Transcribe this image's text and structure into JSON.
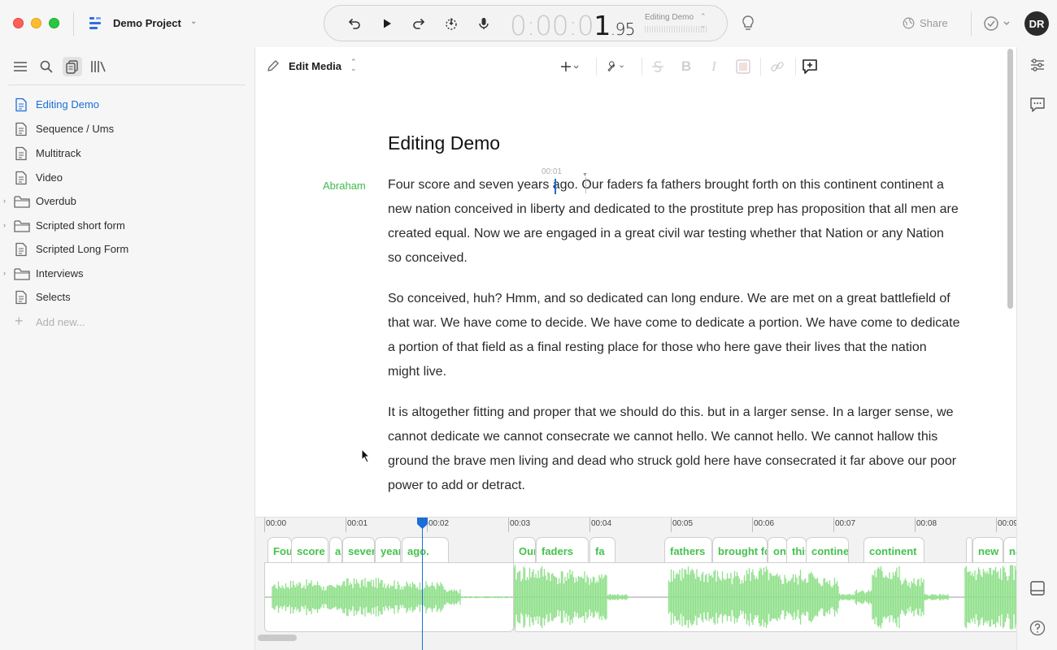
{
  "window": {
    "project_name": "Demo Project",
    "timecode_dim": "0:00:0",
    "timecode_hl": "1",
    "timecode_frac": ".95",
    "composition": "Editing Demo",
    "share_label": "Share",
    "avatar_initials": "DR"
  },
  "sidebar": {
    "items": [
      {
        "label": "Editing Demo",
        "type": "doc",
        "selected": true
      },
      {
        "label": "Sequence / Ums",
        "type": "doc"
      },
      {
        "label": "Multitrack",
        "type": "doc"
      },
      {
        "label": "Video",
        "type": "doc"
      },
      {
        "label": "Overdub",
        "type": "folder"
      },
      {
        "label": "Scripted short form",
        "type": "folder"
      },
      {
        "label": "Scripted Long Form",
        "type": "doc"
      },
      {
        "label": "Interviews",
        "type": "folder"
      },
      {
        "label": "Selects",
        "type": "doc"
      }
    ],
    "add_label": "Add new..."
  },
  "editor": {
    "mode_label": "Edit Media",
    "doc_title": "Editing Demo",
    "speaker": "Abraham",
    "timestamp_marker": "00:01",
    "paragraphs": [
      "Four  score and seven years ago. Our faders fa fathers brought forth on this continent continent a new nation conceived in liberty and dedicated to the prostitute prep has proposition that all men are created equal. Now we are engaged in a great civil war testing whether that Nation or any Nation so conceived.",
      "So conceived, huh? Hmm, and so dedicated can long endure. We are met on a great battlefield of that war. We have come to decide.  We have come to dedicate a portion. We have come to dedicate a portion of that field as a final resting place for those who here gave their lives that the nation might live.",
      "It is altogether fitting and proper that we should do this.  but in a larger sense. In a larger sense, we cannot dedicate we cannot consecrate we cannot hello.  We cannot hello. We cannot hallow this ground the brave men living and dead who struck gold here have consecrated it far above our poor power to add or detract."
    ]
  },
  "timeline": {
    "ticks": [
      "00:00",
      "00:01",
      "00:02",
      "00:03",
      "00:04",
      "00:05",
      "00:06",
      "00:07",
      "00:08",
      "00:09"
    ],
    "playhead_seconds": 1.95,
    "words": [
      "Four",
      "score",
      "and",
      "seven",
      "years",
      "ago.",
      "Our",
      "faders",
      "fa",
      "fathers",
      "brought forth",
      "on",
      "this",
      "continent",
      "continent",
      "a",
      "new",
      "nation"
    ],
    "waveform_color": "#8fe08a",
    "accent_color": "#1b6ed6",
    "speaker_color": "#3fbb4a"
  }
}
